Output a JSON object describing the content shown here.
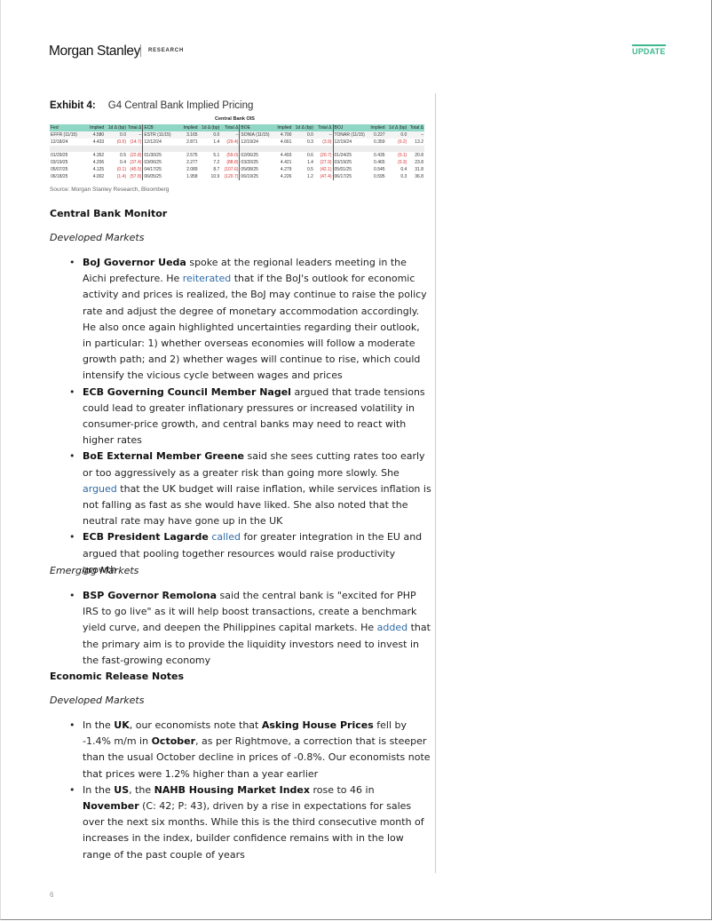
{
  "header": {
    "brand": "Morgan Stanley",
    "section": "RESEARCH",
    "badge": "UPDATE"
  },
  "exhibit": {
    "label": "Exhibit 4:",
    "title": "G4 Central Bank Implied Pricing",
    "table_title": "Central Bank OIS",
    "columns": {
      "fed": [
        "Fed",
        "Implied",
        "1d Δ (bp)",
        "Total Δ"
      ],
      "ecb": [
        "ECB",
        "Implied",
        "1d Δ (bp)",
        "Total Δ"
      ],
      "boe": [
        "BOE",
        "Implied",
        "1d Δ (bp)",
        "Total Δ"
      ],
      "boj": [
        "BOJ",
        "Implied",
        "1d Δ (bp)",
        "Total Δ"
      ]
    },
    "rows": [
      {
        "type": "ref",
        "cells": [
          "EFFR (11/15)",
          "4.580",
          "0.0",
          "–",
          "ESTR (11/15)",
          "3.165",
          "0.0",
          "–",
          "SONIA (11/15)",
          "4.700",
          "0.0",
          "–",
          "TONAR (11/15)",
          "0.227",
          "0.0",
          "–"
        ]
      },
      {
        "type": "data",
        "cells": [
          "12/18/24",
          "4.433",
          "(0.0)",
          "(14.7)",
          "12/12/24",
          "2.871",
          "1.4",
          "(29.4)",
          "12/19/24",
          "4.661",
          "0.3",
          "(3.9)",
          "12/19/24",
          "0.359",
          "(0.2)",
          "13.2"
        ]
      },
      {
        "type": "blank",
        "cells": [
          "",
          "",
          "",
          "",
          "",
          "",
          "",
          "",
          "",
          "",
          "",
          "",
          "",
          "",
          "",
          ""
        ]
      },
      {
        "type": "data",
        "cells": [
          "01/29/25",
          "4.352",
          "0.5",
          "(22.8)",
          "01/30/25",
          "2.575",
          "5.1",
          "(59.0)",
          "02/06/25",
          "4.493",
          "0.6",
          "(20.7)",
          "01/24/25",
          "0.435",
          "(0.1)",
          "20.8"
        ]
      },
      {
        "type": "data",
        "cells": [
          "03/19/25",
          "4.206",
          "0.4",
          "(37.4)",
          "03/06/25",
          "2.277",
          "7.2",
          "(88.8)",
          "03/20/25",
          "4.421",
          "1.4",
          "(27.9)",
          "03/19/25",
          "0.465",
          "(0.3)",
          "23.8"
        ]
      },
      {
        "type": "data",
        "cells": [
          "05/07/25",
          "4.125",
          "(0.1)",
          "(45.5)",
          "04/17/25",
          "2.089",
          "8.7",
          "(107.6)",
          "05/08/25",
          "4.279",
          "0.5",
          "(42.1)",
          "05/01/25",
          "0.545",
          "0.4",
          "31.8"
        ]
      },
      {
        "type": "data",
        "cells": [
          "06/18/25",
          "4.002",
          "(1.4)",
          "(57.8)",
          "06/05/25",
          "1.958",
          "10.9",
          "(120.7)",
          "06/19/25",
          "4.226",
          "1.2",
          "(47.4)",
          "06/17/25",
          "0.595",
          "0.3",
          "36.8"
        ]
      }
    ],
    "source": "Source: Morgan Stanley Research, Bloomberg"
  },
  "central_bank_monitor": {
    "heading": "Central Bank Monitor",
    "developed": {
      "heading": "Developed Markets",
      "items": [
        {
          "bold": "BoJ Governor Ueda",
          "pre": " spoke at the regional leaders meeting in the Aichi prefecture. He ",
          "link": "reiterated",
          "post": " that if the BoJ's outlook for economic activity and prices is realized, the BoJ may continue to raise the policy rate and adjust the degree of monetary accommodation accordingly. He also once again highlighted uncertainties regarding their outlook, in particular: 1) whether overseas economies will follow a moderate growth path; and 2) whether wages will continue to rise, which could intensify the vicious cycle between wages and prices"
        },
        {
          "bold": "ECB Governing Council Member Nagel",
          "pre": " argued that trade tensions could lead to greater inflationary pressures or increased volatility in consumer-price growth, and central banks may need to react with higher rates",
          "link": "",
          "post": ""
        },
        {
          "bold": "BoE External Member Greene",
          "pre": " said she sees cutting rates too early or too aggressively as a greater risk than going more slowly. She ",
          "link": "argued",
          "post": " that the UK budget will raise inflation, while services inflation is not falling as fast as she would have liked. She also noted that the neutral rate may have gone up in the UK"
        },
        {
          "bold": "ECB President Lagarde",
          "pre": " ",
          "link": "called",
          "post": " for greater integration in the EU and argued that pooling together resources would raise productivity growth"
        }
      ]
    },
    "emerging": {
      "heading": "Emerging Markets",
      "items": [
        {
          "bold": "BSP Governor Remolona",
          "pre": " said the central bank is \"excited for PHP IRS to go live\" as it will help boost transactions, create a benchmark yield curve, and deepen the Philippines capital markets. He ",
          "link": "added",
          "post": " that the primary aim is to provide the liquidity investors need to invest in the fast-growing economy"
        }
      ]
    }
  },
  "economic_release_notes": {
    "heading": "Economic Release Notes",
    "developed": {
      "heading": "Developed Markets",
      "uk": {
        "t1": "In the ",
        "b1": "UK",
        "t2": ", our economists note that ",
        "b2": "Asking House Prices",
        "t3": " fell by -1.4% m/m in ",
        "b3": "October",
        "t4": ", as per Rightmove, a correction that is steeper than the usual October decline in prices of -0.8%. Our economists note that prices were 1.2% higher than a year earlier"
      },
      "us": {
        "t1": "In the ",
        "b1": "US",
        "t2": ", the ",
        "b2": "NAHB Housing Market Index",
        "t3": " rose to 46 in ",
        "b3": "November",
        "t4": " (C: 42; P: 43), driven by a rise in expectations for sales over the next six months. While this is the third consecutive month of increases in the index, builder confidence remains with in the low range of the past couple of years"
      }
    }
  },
  "footer": {
    "page_number": "6"
  }
}
